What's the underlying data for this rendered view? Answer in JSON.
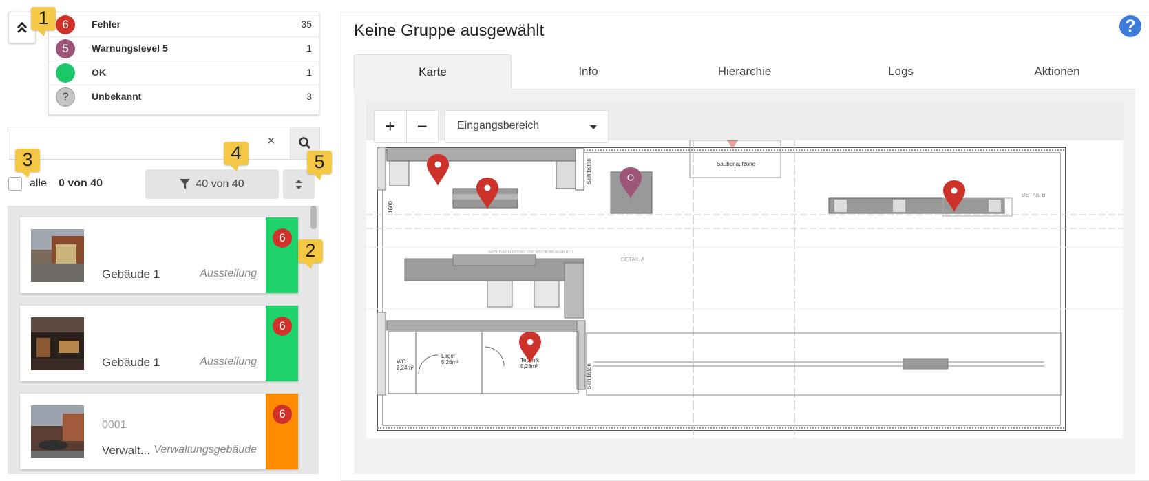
{
  "status_summary": {
    "rows": [
      {
        "symbol": "6",
        "label": "Fehler",
        "count": "35",
        "color": "#d0322a"
      },
      {
        "symbol": "5",
        "label": "Warnungslevel 5",
        "count": "1",
        "color": "#9d5678"
      },
      {
        "symbol": "",
        "label": "OK",
        "count": "1",
        "color": "#1cc76a"
      },
      {
        "symbol": "?",
        "label": "Unbekannt",
        "count": "3",
        "color": "#b9b9b9"
      }
    ]
  },
  "badges": {
    "b1": "1",
    "b2": "2",
    "b3": "3",
    "b4": "4",
    "b5": "5"
  },
  "search": {
    "value": "",
    "clear_icon": "×"
  },
  "selection": {
    "all_label": "alle",
    "count_label": "0 von 40"
  },
  "filter": {
    "label": "40 von 40"
  },
  "list": {
    "items": [
      {
        "code": "",
        "name": "Gebäude 1",
        "type": "Ausstellung",
        "status": "6",
        "status_color": "#1ed36c"
      },
      {
        "code": "",
        "name": "Gebäude 1",
        "type": "Ausstellung",
        "status": "6",
        "status_color": "#1ed36c"
      },
      {
        "code": "0001",
        "name": "Verwalt...",
        "type": "Verwaltungsgebäude",
        "status": "6",
        "status_color": "#ff8c00"
      }
    ]
  },
  "panel": {
    "title": "Keine Gruppe ausgewählt",
    "help_icon": "?",
    "tabs": [
      "Karte",
      "Info",
      "Hierarchie",
      "Logs",
      "Aktionen"
    ],
    "active_tab": "Karte"
  },
  "map": {
    "zoom_in": "+",
    "zoom_out": "−",
    "floor_select": "Eingangsbereich",
    "labels": {
      "sauberlaufzone": "Sauberlaufzone",
      "wc": "WC",
      "wc_area": "2,24m²",
      "lager": "Lager",
      "lager_area": "5,26m²",
      "technik": "Technik",
      "technik_area": "8,28m²",
      "detail_a": "DETAIL A",
      "detail_b": "DETAIL B",
      "sichtbeton_1": "Sichtbeton",
      "sichtbeton_2": "Sichtbeton",
      "dim_1600": "1600",
      "front_note": "FRONTVERKLEIDUNG UND TASCHENBLAGEN NEU"
    }
  }
}
